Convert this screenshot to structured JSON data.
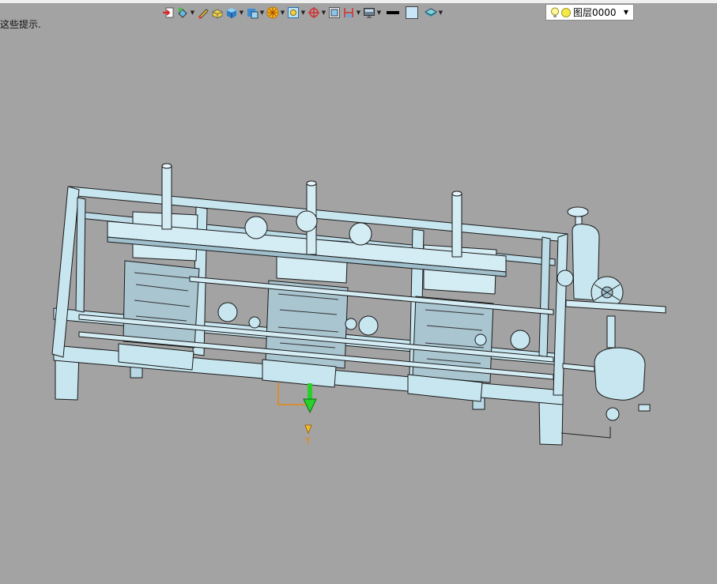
{
  "hint": "这些提示.",
  "toolbar": {
    "items": [
      {
        "icon": "exit-icon"
      },
      {
        "icon": "paint-bucket-icon",
        "dropdown": true
      },
      {
        "icon": "eraser-icon"
      },
      {
        "icon": "solid-block-icon"
      },
      {
        "icon": "shaded-cube-icon",
        "dropdown": true
      },
      {
        "icon": "view-orient-icon",
        "dropdown": true
      },
      {
        "icon": "snap-star-icon",
        "dropdown": true
      },
      {
        "icon": "zoom-fit-icon",
        "dropdown": true
      },
      {
        "icon": "origin-target-icon",
        "dropdown": true
      },
      {
        "icon": "section-view-icon"
      },
      {
        "icon": "dimension-icon",
        "dropdown": true
      },
      {
        "icon": "display-monitor-icon",
        "dropdown": true
      },
      {
        "icon": "line-color-icon"
      },
      {
        "icon": "fill-color-icon"
      },
      {
        "icon": "layer-stack-icon",
        "dropdown": true
      }
    ]
  },
  "layer_selector": {
    "value": "图层0000"
  },
  "axis": {
    "label": "Y"
  },
  "colors": {
    "background": "#a3a3a3",
    "model_fill": "#c8e6f0",
    "model_edge": "#1a1a1a",
    "axis_green": "#27d12a",
    "axis_orange": "#e58a10"
  }
}
